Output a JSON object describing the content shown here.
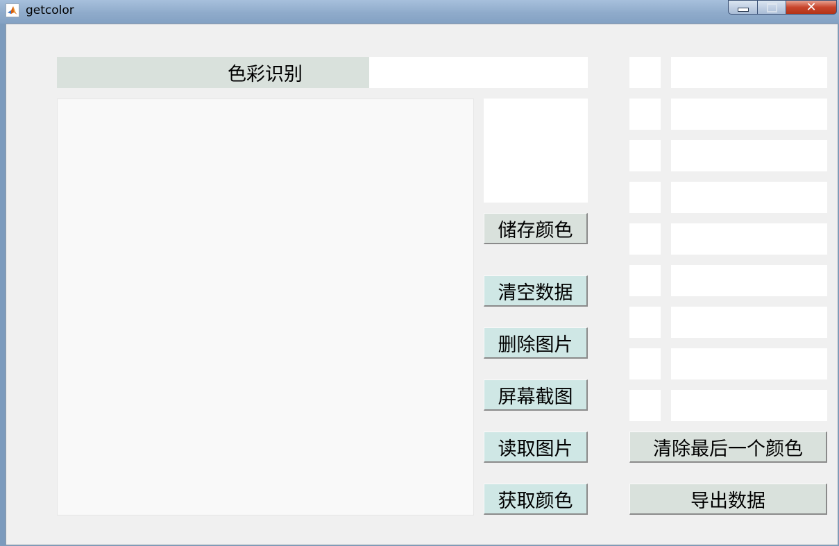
{
  "window": {
    "title": "getcolor",
    "icon": "matlab-logo-icon",
    "controls": [
      "minimize-icon",
      "maximize-icon",
      "close-icon"
    ]
  },
  "header": {
    "label": "色彩识别",
    "value": ""
  },
  "buttons": {
    "save_color": "储存颜色",
    "clear_data": "清空数据",
    "delete_image": "删除图片",
    "screenshot": "屏幕截图",
    "read_image": "读取图片",
    "get_color": "获取颜色",
    "clear_last_color": "清除最后一个颜色",
    "export_data": "导出数据"
  },
  "color_list": [
    {
      "swatch": "",
      "value": ""
    },
    {
      "swatch": "",
      "value": ""
    },
    {
      "swatch": "",
      "value": ""
    },
    {
      "swatch": "",
      "value": ""
    },
    {
      "swatch": "",
      "value": ""
    },
    {
      "swatch": "",
      "value": ""
    },
    {
      "swatch": "",
      "value": ""
    },
    {
      "swatch": "",
      "value": ""
    },
    {
      "swatch": "",
      "value": ""
    }
  ],
  "colors": {
    "panel_background": "#f0f0f0",
    "label_background": "#d9e1dc",
    "button_gray": "#d9e1dc",
    "button_cyan": "#cfe7e5",
    "field_background": "#ffffff"
  }
}
